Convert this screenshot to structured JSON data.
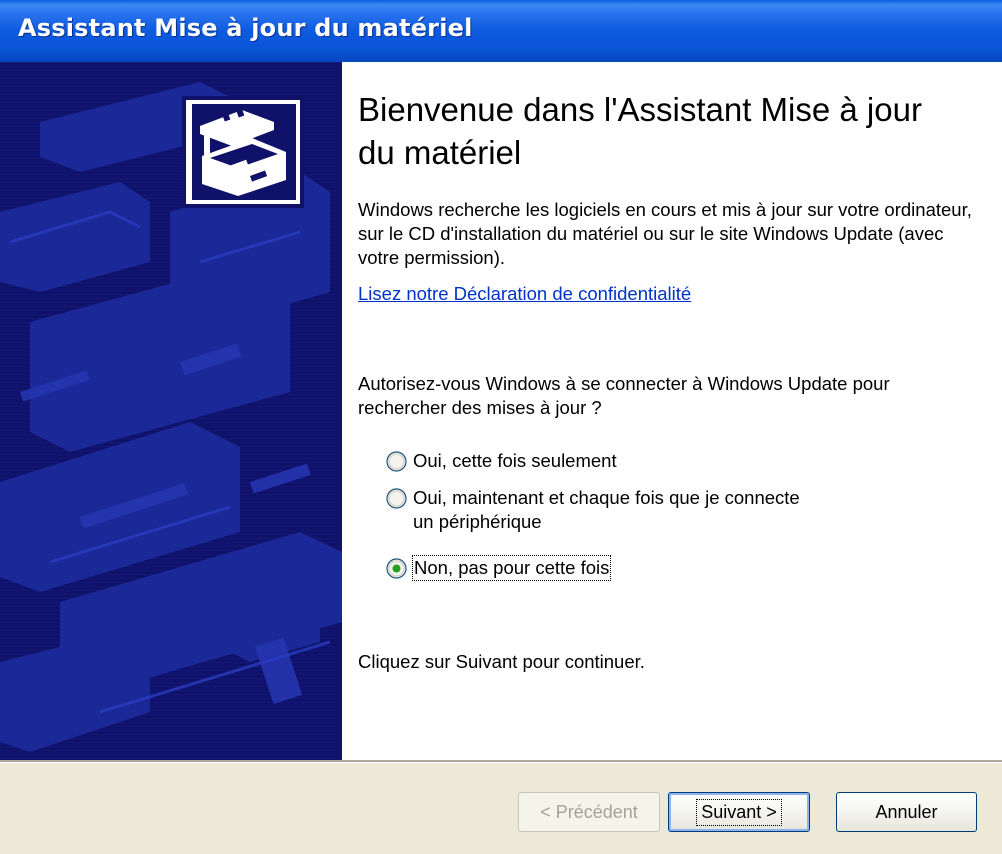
{
  "window": {
    "title": "Assistant Mise à jour du matériel"
  },
  "main": {
    "heading": "Bienvenue dans l'Assistant Mise à jour du matériel",
    "description": "Windows recherche les logiciels en cours et mis à jour sur votre ordinateur, sur le CD d'installation du matériel ou sur le site Windows Update (avec votre permission).",
    "privacy_link": "Lisez notre Déclaration de confidentialité",
    "question": "Autorisez-vous Windows à se connecter à Windows Update pour rechercher des mises à jour ?",
    "options": [
      {
        "label": "Oui, cette fois seulement",
        "selected": false
      },
      {
        "label": "Oui, maintenant et chaque fois que je connecte\nun périphérique",
        "selected": false
      },
      {
        "label": "Non, pas pour cette fois",
        "selected": true
      }
    ],
    "continue_text": "Cliquez sur Suivant pour continuer."
  },
  "buttons": {
    "previous": "< Précédent",
    "next": "Suivant >",
    "cancel": "Annuler"
  },
  "icons": {
    "wizard_banner": "hardware-device-icon",
    "panel_art": "circuit-board-graphic"
  },
  "colors": {
    "titlebar": "#0a54d6",
    "left_panel": "#10126a",
    "link": "#0033cc",
    "dialog_bg": "#ece9d8"
  }
}
